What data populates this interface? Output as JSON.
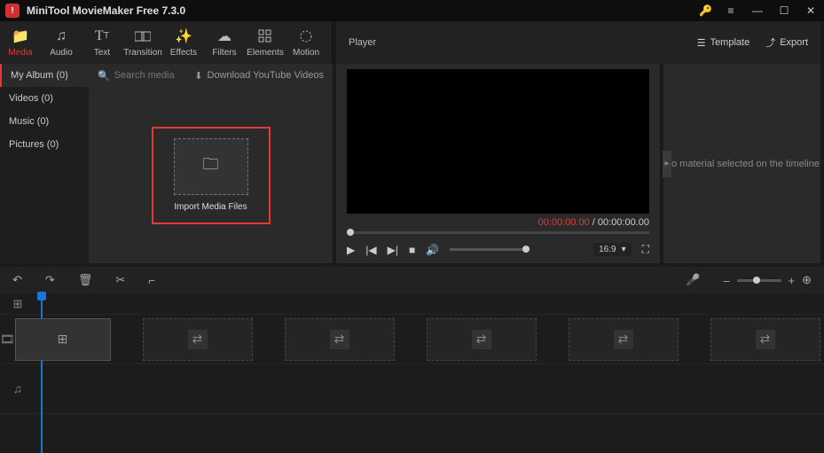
{
  "app": {
    "title": "MiniTool MovieMaker Free 7.3.0"
  },
  "tabs": [
    {
      "label": "Media",
      "icon": "folder"
    },
    {
      "label": "Audio",
      "icon": "music"
    },
    {
      "label": "Text",
      "icon": "text"
    },
    {
      "label": "Transition",
      "icon": "transition"
    },
    {
      "label": "Effects",
      "icon": "effects"
    },
    {
      "label": "Filters",
      "icon": "filters"
    },
    {
      "label": "Elements",
      "icon": "elements"
    },
    {
      "label": "Motion",
      "icon": "motion"
    }
  ],
  "player_header": {
    "title": "Player",
    "template": "Template",
    "export": "Export"
  },
  "sidebar": {
    "items": [
      {
        "label": "My Album (0)",
        "active": true
      },
      {
        "label": "Videos (0)",
        "active": false
      },
      {
        "label": "Music (0)",
        "active": false
      },
      {
        "label": "Pictures (0)",
        "active": false
      }
    ]
  },
  "library": {
    "search_placeholder": "Search media",
    "download_label": "Download YouTube Videos",
    "import_label": "Import Media Files"
  },
  "player": {
    "current_time": "00:00:00.00",
    "total_time": "00:00:00.00",
    "ratio": "16:9"
  },
  "properties": {
    "empty_message": "No material selected on the timeline"
  },
  "timeline": {
    "toolbar": [
      "undo",
      "redo",
      "delete",
      "cut",
      "crop"
    ]
  }
}
